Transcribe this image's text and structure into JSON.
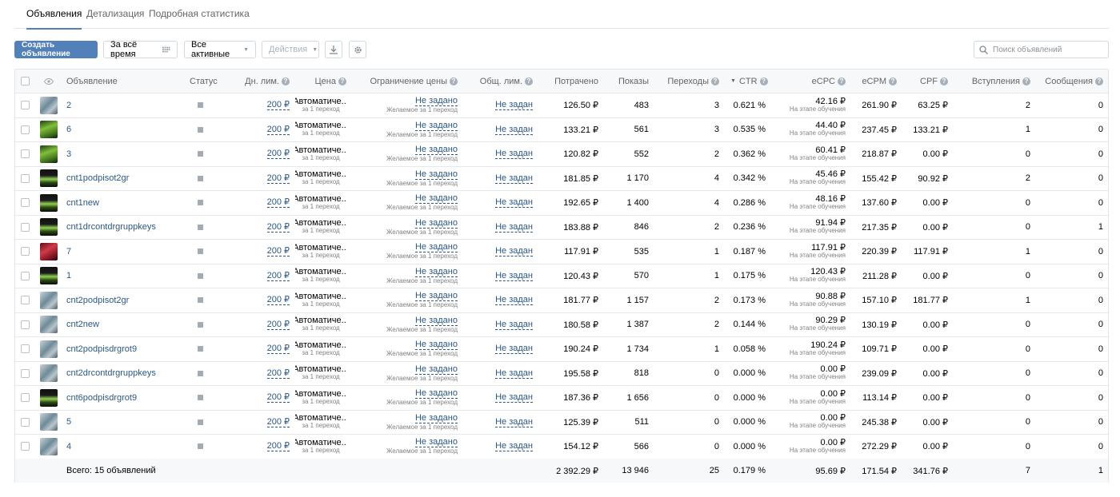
{
  "tabs": [
    {
      "label": "Объявления",
      "active": true
    },
    {
      "label": "Детализация",
      "active": false
    },
    {
      "label": "Подробная статистика",
      "active": false
    }
  ],
  "toolbar": {
    "create_label": "Создать объявление",
    "period_label": "За всё время",
    "filter_label": "Все активные",
    "actions_label": "Действия",
    "search_placeholder": "Поиск объявлений"
  },
  "columns": {
    "ad": "Объявление",
    "status": "Статус",
    "daily_limit": "Дн. лим.",
    "price": "Цена",
    "price_limit": "Ограничение цены",
    "total_limit": "Общ. лим.",
    "spent": "Потрачено",
    "impressions": "Показы",
    "clicks": "Переходы",
    "ctr": "CTR",
    "ecpc": "eCPC",
    "ecpm": "eCPM",
    "cpf": "CPF",
    "joins": "Вступления",
    "messages": "Сообщения"
  },
  "common": {
    "daily_limit": "200 ₽",
    "price": "Автоматиче...",
    "price_sub": "за 1 переход",
    "price_limit": "Не задано",
    "price_limit_sub": "Желаемое за 1 переход",
    "total_limit": "Не задан",
    "ecpc_sub": "На этапе обучения"
  },
  "rows": [
    {
      "name": "2",
      "thumb": "photo",
      "spent": "126.50 ₽",
      "impressions": "483",
      "clicks": "3",
      "ctr": "0.621 %",
      "ecpc": "42.16 ₽",
      "ecpm": "261.90 ₽",
      "cpf": "63.25 ₽",
      "joins": "2",
      "messages": "0"
    },
    {
      "name": "6",
      "thumb": "green",
      "spent": "133.21 ₽",
      "impressions": "561",
      "clicks": "3",
      "ctr": "0.535 %",
      "ecpc": "44.40 ₽",
      "ecpm": "237.45 ₽",
      "cpf": "133.21 ₽",
      "joins": "1",
      "messages": "0"
    },
    {
      "name": "3",
      "thumb": "green",
      "spent": "120.82 ₽",
      "impressions": "552",
      "clicks": "2",
      "ctr": "0.362 %",
      "ecpc": "60.41 ₽",
      "ecpm": "218.87 ₽",
      "cpf": "0.00 ₽",
      "joins": "0",
      "messages": "0"
    },
    {
      "name": "cnt1podpisot2gr",
      "thumb": "dark",
      "spent": "181.85 ₽",
      "impressions": "1 170",
      "clicks": "4",
      "ctr": "0.342 %",
      "ecpc": "45.46 ₽",
      "ecpm": "155.42 ₽",
      "cpf": "90.92 ₽",
      "joins": "2",
      "messages": "0"
    },
    {
      "name": "cnt1new",
      "thumb": "dark",
      "spent": "192.65 ₽",
      "impressions": "1 400",
      "clicks": "4",
      "ctr": "0.286 %",
      "ecpc": "48.16 ₽",
      "ecpm": "137.60 ₽",
      "cpf": "0.00 ₽",
      "joins": "0",
      "messages": "0"
    },
    {
      "name": "cnt1drcontdrgruppkeys",
      "thumb": "dark",
      "spent": "183.88 ₽",
      "impressions": "846",
      "clicks": "2",
      "ctr": "0.236 %",
      "ecpc": "91.94 ₽",
      "ecpm": "217.35 ₽",
      "cpf": "0.00 ₽",
      "joins": "0",
      "messages": "1"
    },
    {
      "name": "7",
      "thumb": "red",
      "spent": "117.91 ₽",
      "impressions": "535",
      "clicks": "1",
      "ctr": "0.187 %",
      "ecpc": "117.91 ₽",
      "ecpm": "220.39 ₽",
      "cpf": "117.91 ₽",
      "joins": "1",
      "messages": "0"
    },
    {
      "name": "1",
      "thumb": "dark",
      "spent": "120.43 ₽",
      "impressions": "570",
      "clicks": "1",
      "ctr": "0.175 %",
      "ecpc": "120.43 ₽",
      "ecpm": "211.28 ₽",
      "cpf": "0.00 ₽",
      "joins": "0",
      "messages": "0"
    },
    {
      "name": "cnt2podpisot2gr",
      "thumb": "photo",
      "spent": "181.77 ₽",
      "impressions": "1 157",
      "clicks": "2",
      "ctr": "0.173 %",
      "ecpc": "90.88 ₽",
      "ecpm": "157.10 ₽",
      "cpf": "181.77 ₽",
      "joins": "1",
      "messages": "0"
    },
    {
      "name": "cnt2new",
      "thumb": "photo",
      "spent": "180.58 ₽",
      "impressions": "1 387",
      "clicks": "2",
      "ctr": "0.144 %",
      "ecpc": "90.29 ₽",
      "ecpm": "130.19 ₽",
      "cpf": "0.00 ₽",
      "joins": "0",
      "messages": "0"
    },
    {
      "name": "cnt2podpisdrgrot9",
      "thumb": "photo",
      "spent": "190.24 ₽",
      "impressions": "1 734",
      "clicks": "1",
      "ctr": "0.058 %",
      "ecpc": "190.24 ₽",
      "ecpm": "109.71 ₽",
      "cpf": "0.00 ₽",
      "joins": "0",
      "messages": "0"
    },
    {
      "name": "cnt2drcontdrgruppkeys",
      "thumb": "photo",
      "spent": "195.58 ₽",
      "impressions": "818",
      "clicks": "0",
      "ctr": "0.000 %",
      "ecpc": "0.00 ₽",
      "ecpm": "239.09 ₽",
      "cpf": "0.00 ₽",
      "joins": "0",
      "messages": "0"
    },
    {
      "name": "cnt6podpisdrgrot9",
      "thumb": "dark",
      "spent": "187.36 ₽",
      "impressions": "1 656",
      "clicks": "0",
      "ctr": "0.000 %",
      "ecpc": "0.00 ₽",
      "ecpm": "113.14 ₽",
      "cpf": "0.00 ₽",
      "joins": "0",
      "messages": "0"
    },
    {
      "name": "5",
      "thumb": "photo",
      "spent": "125.39 ₽",
      "impressions": "511",
      "clicks": "0",
      "ctr": "0.000 %",
      "ecpc": "0.00 ₽",
      "ecpm": "245.38 ₽",
      "cpf": "0.00 ₽",
      "joins": "0",
      "messages": "0"
    },
    {
      "name": "4",
      "thumb": "photo",
      "spent": "154.12 ₽",
      "impressions": "566",
      "clicks": "0",
      "ctr": "0.000 %",
      "ecpc": "0.00 ₽",
      "ecpm": "272.29 ₽",
      "cpf": "0.00 ₽",
      "joins": "0",
      "messages": "0"
    }
  ],
  "totals": {
    "label": "Всего: 15 объявлений",
    "spent": "2 392.29 ₽",
    "impressions": "13 946",
    "clicks": "25",
    "ctr": "0.179 %",
    "ecpc": "95.69 ₽",
    "ecpm": "171.54 ₽",
    "cpf": "341.76 ₽",
    "joins": "7",
    "messages": "1"
  },
  "colors": {
    "accent": "#5181b8",
    "link": "#2a5885"
  }
}
